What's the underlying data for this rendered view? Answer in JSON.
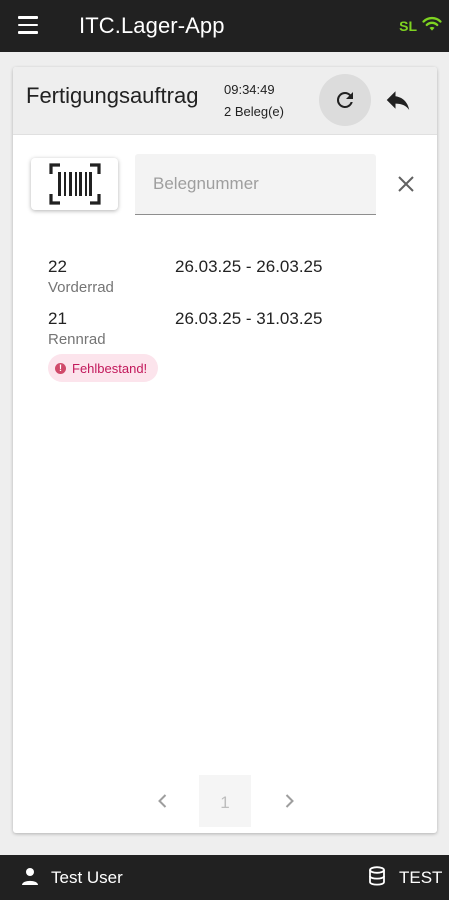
{
  "app": {
    "title": "ITC.Lager-App",
    "connection_label": "SL",
    "accent_color": "#7ed321"
  },
  "header": {
    "title": "Fertigungsauftrag",
    "time": "09:34:49",
    "count": "2 Beleg(e)"
  },
  "search": {
    "placeholder": "Belegnummer",
    "value": ""
  },
  "orders": [
    {
      "id": "22",
      "dates": "26.03.25 - 26.03.25",
      "name": "Vorderrad",
      "status": ""
    },
    {
      "id": "21",
      "dates": "26.03.25 - 31.03.25",
      "name": "Rennrad",
      "status": "Fehlbestand!"
    }
  ],
  "pager": {
    "prev_icon": "chevron-left-icon",
    "current_page": "1",
    "next_icon": "chevron-right-icon"
  },
  "footer": {
    "user": "Test User",
    "database": "TEST"
  },
  "icons": {
    "menu": "menu-icon",
    "wifi": "wifi-icon",
    "refresh": "refresh-icon",
    "back": "reply-icon",
    "barcode": "barcode-scan-icon",
    "clear": "close-icon",
    "alert": "alert-circle-icon",
    "user": "user-icon",
    "database": "database-icon"
  }
}
